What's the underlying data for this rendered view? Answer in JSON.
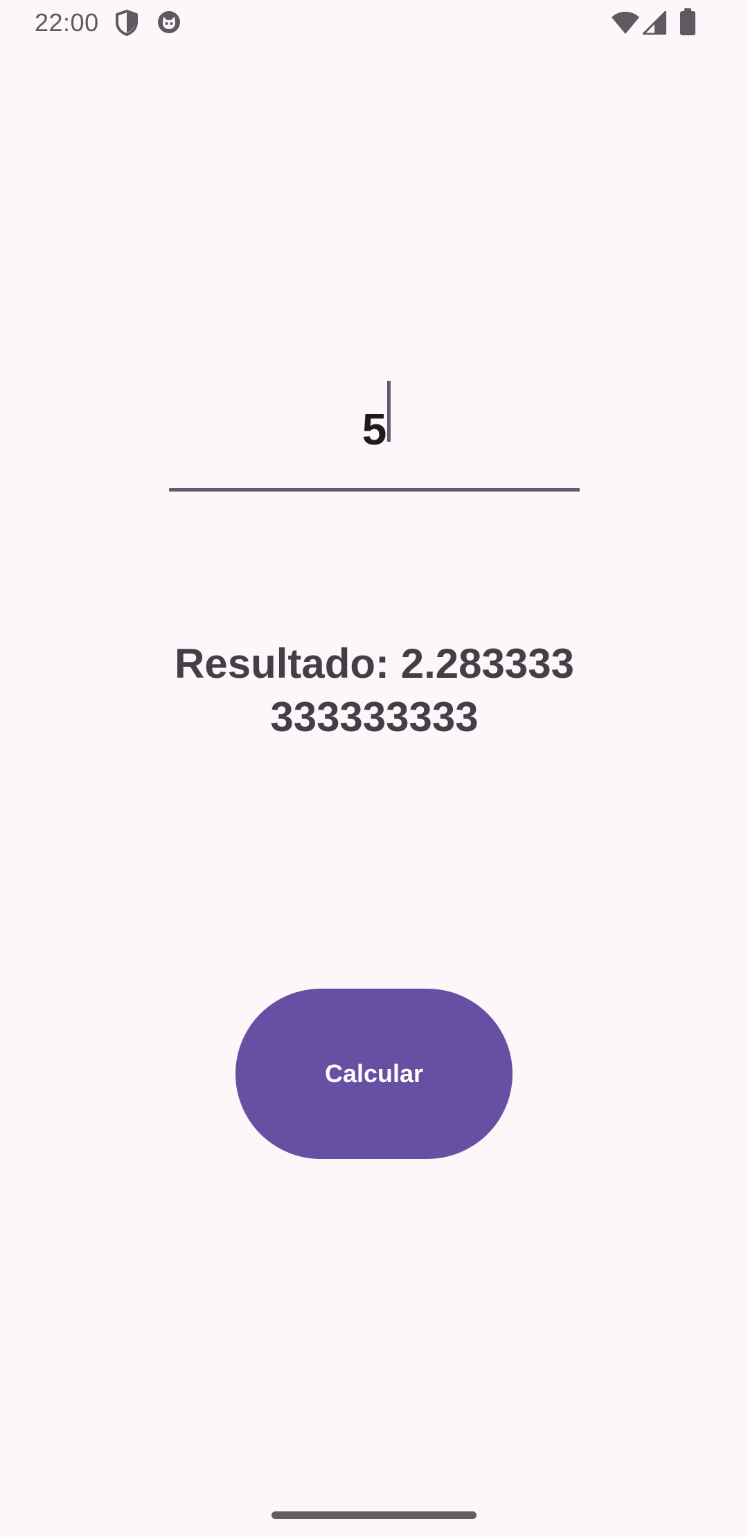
{
  "status_bar": {
    "time": "22:00",
    "left_icons": [
      "shield-icon",
      "cat-face-icon"
    ],
    "right_icons": [
      "wifi-icon",
      "cell-signal-icon",
      "battery-icon"
    ]
  },
  "input": {
    "value": "5"
  },
  "result": {
    "text": "Resultado: 2.283333333333333"
  },
  "calc_button": {
    "label": "Calcular"
  },
  "colors": {
    "background": "#FEF7FA",
    "accent": "#6750A4",
    "underline": "#625B71",
    "result_text": "#433F48",
    "status_icons": "#5E5A61"
  }
}
